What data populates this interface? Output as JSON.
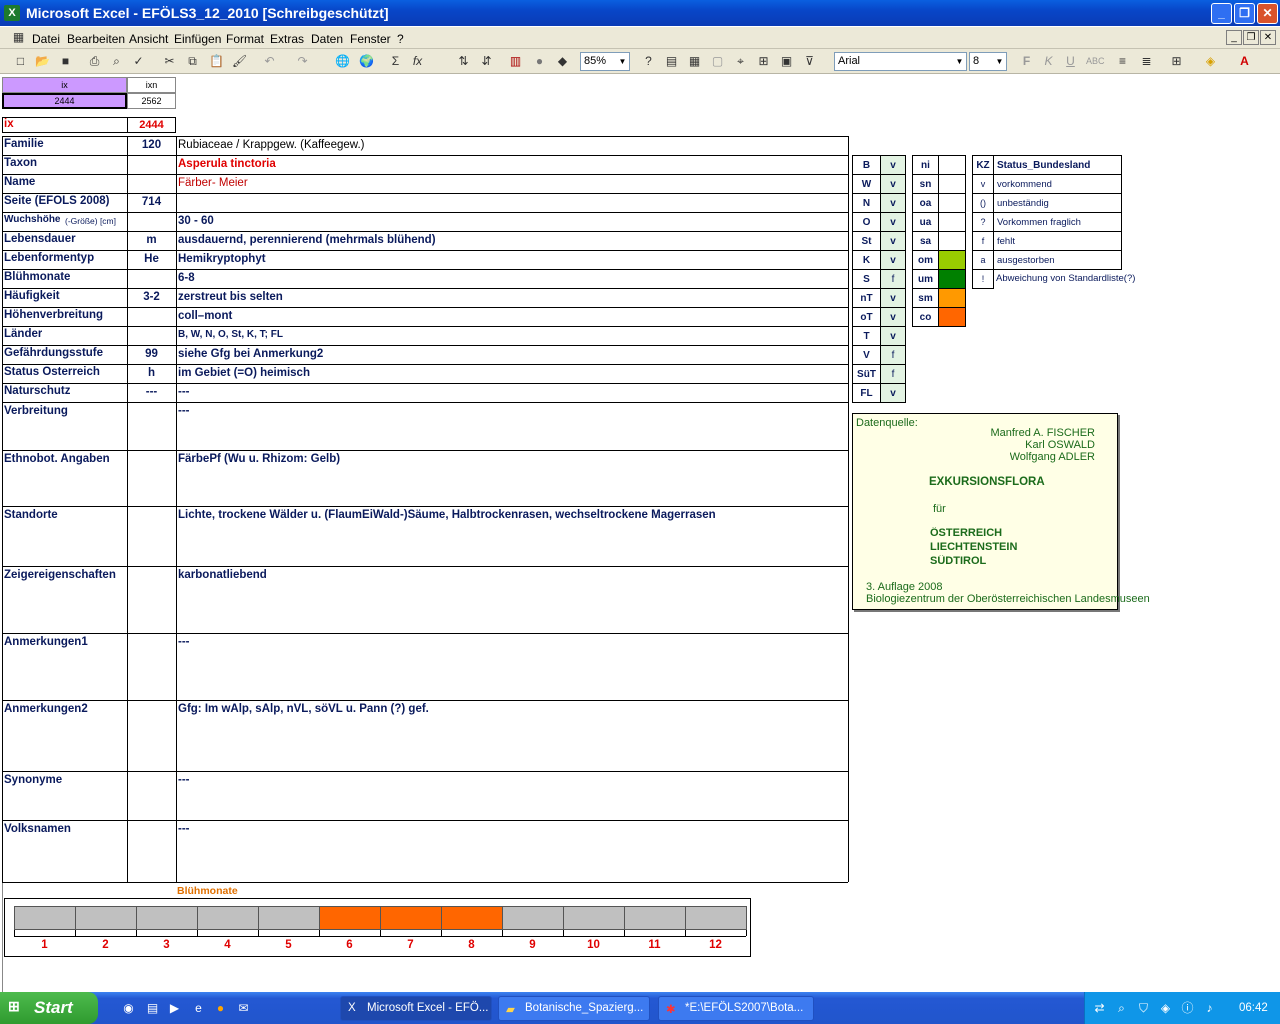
{
  "window": {
    "title": "Microsoft Excel - EFÖLS3_12_2010  [Schreibgeschützt]",
    "excel_icon": "X"
  },
  "menu": {
    "items": [
      "Datei",
      "Bearbeiten",
      "Ansicht",
      "Einfügen",
      "Format",
      "Extras",
      "Daten",
      "Fenster",
      "?"
    ]
  },
  "toolbar": {
    "zoom": "85%",
    "font": "Arial",
    "size": "8"
  },
  "header_cells": {
    "ix_label": "ix",
    "ixn_label": "ixn",
    "ix_value": "2444",
    "ixn_value": "2562",
    "ix2_label": "ix",
    "ix2_value": "2444"
  },
  "rows": [
    {
      "label": "Familie",
      "code": "120",
      "value": "Rubiaceae  /  Krappgew. (Kaffeegew.)"
    },
    {
      "label": "Taxon",
      "code": "",
      "value": "Asperula tinctoria"
    },
    {
      "label": "Name",
      "code": "",
      "value": "Färber- Meier"
    },
    {
      "label": "Seite (EFÖLS 2008)",
      "code": "714",
      "value": ""
    },
    {
      "label": "Wuchshöhe",
      "label_small": " (-Größe) [cm]",
      "code": "",
      "value": " 30 - 60"
    },
    {
      "label": "Lebensdauer",
      "code": "m",
      "value": "ausdauernd, perennierend (mehrmals blühend)"
    },
    {
      "label": "Lebenformentyp",
      "code": "He",
      "value": "Hemikryptophyt"
    },
    {
      "label": "Blühmonate",
      "code": "",
      "value": " 6-8"
    },
    {
      "label": "Häufigkeit",
      "code": "3-2",
      "value": "zerstreut bis selten"
    },
    {
      "label": "Höhenverbreitung",
      "code": "",
      "value": "coll–mont"
    },
    {
      "label": "Länder",
      "code": "",
      "value": "B, W, N, O, St, K, T; FL"
    },
    {
      "label": "Gefährdungsstufe",
      "code": "99",
      "value": "siehe Gfg bei Anmerkung2"
    },
    {
      "label": "Status Österreich",
      "code": "h",
      "value": "im Gebiet (=Ö) heimisch"
    },
    {
      "label": "Naturschutz",
      "code": "---",
      "value": "---"
    }
  ],
  "tall_rows": [
    {
      "label": "Verbreitung",
      "value": "---"
    },
    {
      "label": "Ethnobot. Angaben",
      "value": "FärbePf (Wu u. Rhizom: Gelb)"
    },
    {
      "label": "Standorte",
      "value": "Lichte, trockene Wälder u. (FlaumEiWald-)Säume, Halbtrockenrasen, wechseltrockene Magerrasen"
    },
    {
      "label": "Zeigereigenschaften",
      "value": " karbonatliebend"
    },
    {
      "label": "Anmerkungen1",
      "value": "---"
    },
    {
      "label": "Anmerkungen2",
      "value": "Gfg: Im wAlp, sAlp, nVL, söVL u. Pann (?) gef."
    },
    {
      "label": "Synonyme",
      "value": "---"
    },
    {
      "label": "Volksnamen",
      "value": "---"
    }
  ],
  "regions": [
    {
      "code": "B",
      "status": "v"
    },
    {
      "code": "W",
      "status": "v"
    },
    {
      "code": "N",
      "status": "v"
    },
    {
      "code": "O",
      "status": "v"
    },
    {
      "code": "St",
      "status": "v"
    },
    {
      "code": "K",
      "status": "v"
    },
    {
      "code": "S",
      "status": "f"
    },
    {
      "code": "nT",
      "status": "v"
    },
    {
      "code": "oT",
      "status": "v"
    },
    {
      "code": "T",
      "status": "v"
    },
    {
      "code": "V",
      "status": "f"
    },
    {
      "code": "SüT",
      "status": "f"
    },
    {
      "code": "FL",
      "status": "v"
    }
  ],
  "altitude": [
    {
      "code": "ni",
      "color": "#ffffff"
    },
    {
      "code": "sn",
      "color": "#ffffff"
    },
    {
      "code": "oa",
      "color": "#ffffff"
    },
    {
      "code": "ua",
      "color": "#ffffff"
    },
    {
      "code": "sa",
      "color": "#ffffff"
    },
    {
      "code": "om",
      "color": "#99cc00"
    },
    {
      "code": "um",
      "color": "#008000"
    },
    {
      "code": "sm",
      "color": "#ff9900"
    },
    {
      "code": "co",
      "color": "#ff6600"
    }
  ],
  "legend": {
    "kz": "KZ",
    "title": "Status_Bundesland",
    "items": [
      {
        "k": "v",
        "t": "vorkommend"
      },
      {
        "k": "()",
        "t": "unbeständig"
      },
      {
        "k": "?",
        "t": "Vorkommen fraglich"
      },
      {
        "k": "f",
        "t": "fehlt"
      },
      {
        "k": "a",
        "t": "ausgestorben"
      },
      {
        "k": "!",
        "t": "Abweichung von Standardliste(?)"
      }
    ]
  },
  "source": {
    "heading": "Datenquelle:",
    "authors": [
      "Manfred A. FISCHER",
      "Karl OSWALD",
      "Wolfgang ADLER"
    ],
    "title": "EXKURSIONSFLORA",
    "fuer": "für",
    "countries": [
      "ÖSTERREICH",
      "LIECHTENSTEIN",
      "SÜDTIROL"
    ],
    "edition": "3. Auflage 2008",
    "publisher": "Biologiezentrum der Oberösterreichischen Landesmuseen"
  },
  "bloom": {
    "title": "Blühmonate",
    "months": [
      "1",
      "2",
      "3",
      "4",
      "5",
      "6",
      "7",
      "8",
      "9",
      "10",
      "11",
      "12"
    ],
    "active": [
      6,
      7,
      8
    ],
    "active_color": "#ff6600",
    "inactive_color": "#c0c0c0"
  },
  "taskbar": {
    "start": "Start",
    "buttons": [
      "Microsoft Excel - EFÖ...",
      "Botanische_Spazierg...",
      "*E:\\EFÖLS2007\\Bota..."
    ],
    "clock": "06:42"
  },
  "colors": {
    "label": "#0a1a5c",
    "red": "#e00000",
    "purple": "#cc99ff"
  }
}
